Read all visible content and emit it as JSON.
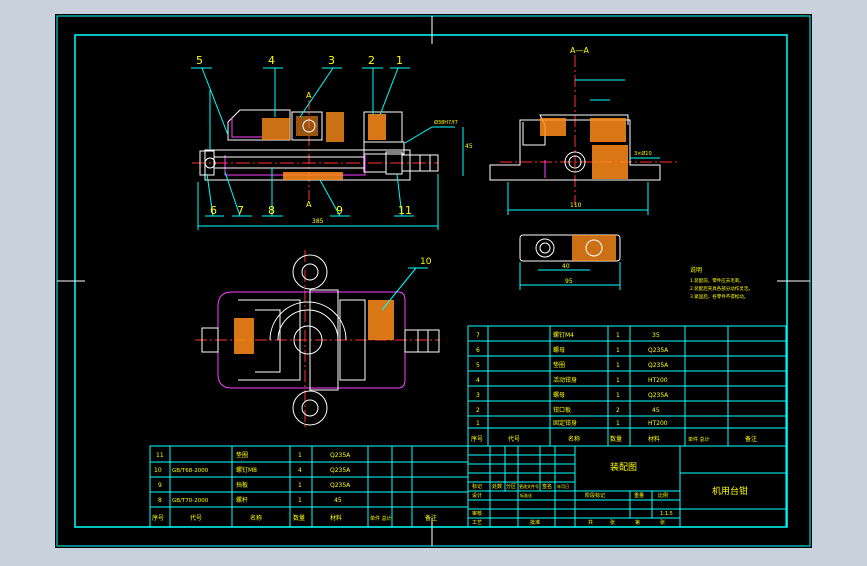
{
  "colors": {
    "background": "#c9d1dc",
    "sheet": "#000000",
    "frame": "#00ffff",
    "outline": "#ffffff",
    "centerline": "#ff3030",
    "hatch": "#ff8c1a",
    "hidden": "#ff40ff",
    "text": "#ffff00",
    "table": "#00ffff"
  },
  "section_label": "A—A",
  "section_marks": [
    "A",
    "A"
  ],
  "callouts": [
    "5",
    "4",
    "3",
    "2",
    "1",
    "6",
    "7",
    "8",
    "9",
    "11",
    "10"
  ],
  "dimensions": {
    "front_length": "385",
    "front_height": "45",
    "side_width": "110",
    "side_fit": "Ø38H7/f7",
    "side_tol": "3×Ø10",
    "small_inner": "40",
    "small_outer": "95"
  },
  "notes": {
    "title": "说明",
    "lines": [
      "1.装配前，零件应去毛刺。",
      "2.装配后夹具各部分动作灵活。",
      "3.紧固后，各零件不得松动。"
    ]
  },
  "parts_upper": [
    {
      "no": "7",
      "code": "",
      "name": "螺钉M4",
      "qty": "1",
      "material": "35",
      "mass": "",
      "remark": ""
    },
    {
      "no": "6",
      "code": "",
      "name": "螺母",
      "qty": "1",
      "material": "Q235A",
      "mass": "",
      "remark": ""
    },
    {
      "no": "5",
      "code": "",
      "name": "垫圈",
      "qty": "1",
      "material": "Q235A",
      "mass": "",
      "remark": ""
    },
    {
      "no": "4",
      "code": "",
      "name": "活动钳身",
      "qty": "1",
      "material": "HT200",
      "mass": "",
      "remark": ""
    },
    {
      "no": "3",
      "code": "",
      "name": "螺母",
      "qty": "1",
      "material": "Q235A",
      "mass": "",
      "remark": ""
    },
    {
      "no": "2",
      "code": "",
      "name": "钳口板",
      "qty": "2",
      "material": "45",
      "mass": "",
      "remark": ""
    },
    {
      "no": "1",
      "code": "",
      "name": "固定钳身",
      "qty": "1",
      "material": "HT200",
      "mass": "",
      "remark": ""
    }
  ],
  "parts_lower": [
    {
      "no": "11",
      "code": "",
      "name": "垫圈",
      "qty": "1",
      "material": "Q235A",
      "mass": "",
      "remark": ""
    },
    {
      "no": "10",
      "code": "GB/T68-2000",
      "name": "螺钉M8",
      "qty": "4",
      "material": "Q235A",
      "mass": "",
      "remark": ""
    },
    {
      "no": "9",
      "code": "",
      "name": "挡板",
      "qty": "1",
      "material": "Q235A",
      "mass": "",
      "remark": ""
    },
    {
      "no": "8",
      "code": "GB/T70-2000",
      "name": "螺杆",
      "qty": "1",
      "material": "45",
      "mass": "",
      "remark": ""
    }
  ],
  "parts_header": {
    "no": "序号",
    "code": "代号",
    "name": "名称",
    "qty": "数量",
    "material": "材料",
    "mass": "单件 总计",
    "remark": "备注"
  },
  "title_block": {
    "drawing_name": "装配图",
    "product_name": "机用台钳",
    "scale": "1:1.5",
    "row_labels": [
      "标记",
      "处数",
      "分区",
      "更改文件号",
      "签名",
      "年月日"
    ],
    "sign_labels": [
      "设计",
      "标准化",
      "审核",
      "工艺",
      "批准"
    ],
    "stage_labels": [
      "阶段标记",
      "重量",
      "比例"
    ],
    "sheet_labels": [
      "共",
      "张",
      "第",
      "张"
    ]
  }
}
